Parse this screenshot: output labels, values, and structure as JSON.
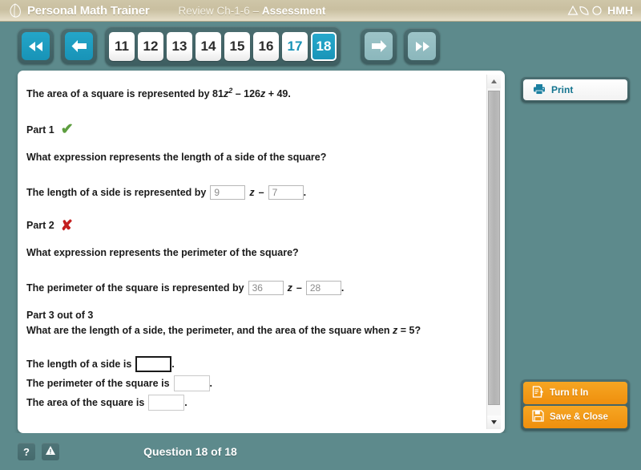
{
  "header": {
    "logo_icon": "leaf-logo-icon",
    "brand": "Personal Math Trainer",
    "assessment_prefix": "Review Ch-1-6 ",
    "assessment_dash": "– ",
    "assessment_name": "Assessment",
    "publisher": "HMH",
    "publisher_glyphs": "triangle-leaf-circle-icon"
  },
  "nav": {
    "first_label": "first-page-button",
    "prev_label": "previous-page-button",
    "next_label": "next-page-button",
    "last_label": "last-page-button",
    "pages": [
      {
        "num": "11",
        "state": "normal"
      },
      {
        "num": "12",
        "state": "normal"
      },
      {
        "num": "13",
        "state": "normal"
      },
      {
        "num": "14",
        "state": "normal"
      },
      {
        "num": "15",
        "state": "normal"
      },
      {
        "num": "16",
        "state": "normal"
      },
      {
        "num": "17",
        "state": "visited"
      },
      {
        "num": "18",
        "state": "current"
      }
    ]
  },
  "question": {
    "stem_pre": "The area of a square is represented by 81",
    "stem_var1": "z",
    "stem_sup": "2",
    "stem_mid": " – 126",
    "stem_var2": "z",
    "stem_post": " + 49.",
    "part1": {
      "label": "Part 1",
      "mark": "✔",
      "mark_name": "correct-check-icon",
      "prompt": "What expression represents the length of a side of the square?",
      "answer_pre": "The length of a side is represented by",
      "value1": "9",
      "var": "z",
      "operator": "–",
      "value2": "7",
      "answer_post": "."
    },
    "part2": {
      "label": "Part 2",
      "mark": "✘",
      "mark_name": "incorrect-x-icon",
      "prompt": "What expression represents the perimeter of the square?",
      "answer_pre": "The perimeter of the square is represented by",
      "value1": "36",
      "var": "z",
      "operator": "–",
      "value2": "28",
      "answer_post": "."
    },
    "part3": {
      "label": "Part 3 out of 3",
      "prompt_pre": "What are the length of a side, the perimeter, and the area of the square when ",
      "prompt_var": "z",
      "prompt_post": " = 5?",
      "rows": [
        {
          "text": "The length of a side is",
          "value": "",
          "period": ".",
          "focused": true
        },
        {
          "text": "The perimeter of the square is",
          "value": "",
          "period": ".",
          "focused": false
        },
        {
          "text": "The area of the square is",
          "value": "",
          "period": ".",
          "focused": false
        }
      ]
    }
  },
  "sidebar": {
    "print_label": "Print",
    "print_icon": "printer-icon",
    "turn_in_label": "Turn It In",
    "turn_in_icon": "document-upload-icon",
    "save_close_label": "Save & Close",
    "save_close_icon": "floppy-disk-icon"
  },
  "footer": {
    "help_label": "?",
    "help_icon": "help-question-icon",
    "alert_icon": "warning-triangle-icon",
    "question_counter": "Question 18 of 18"
  },
  "colors": {
    "app_bg_teal": "#5d8a8c",
    "header_beige": "#c9bfa0",
    "accent_cyan": "#1893b7",
    "orange_button": "#f6a623",
    "correct_green": "#5d9e3f",
    "incorrect_red": "#c41e1e"
  }
}
